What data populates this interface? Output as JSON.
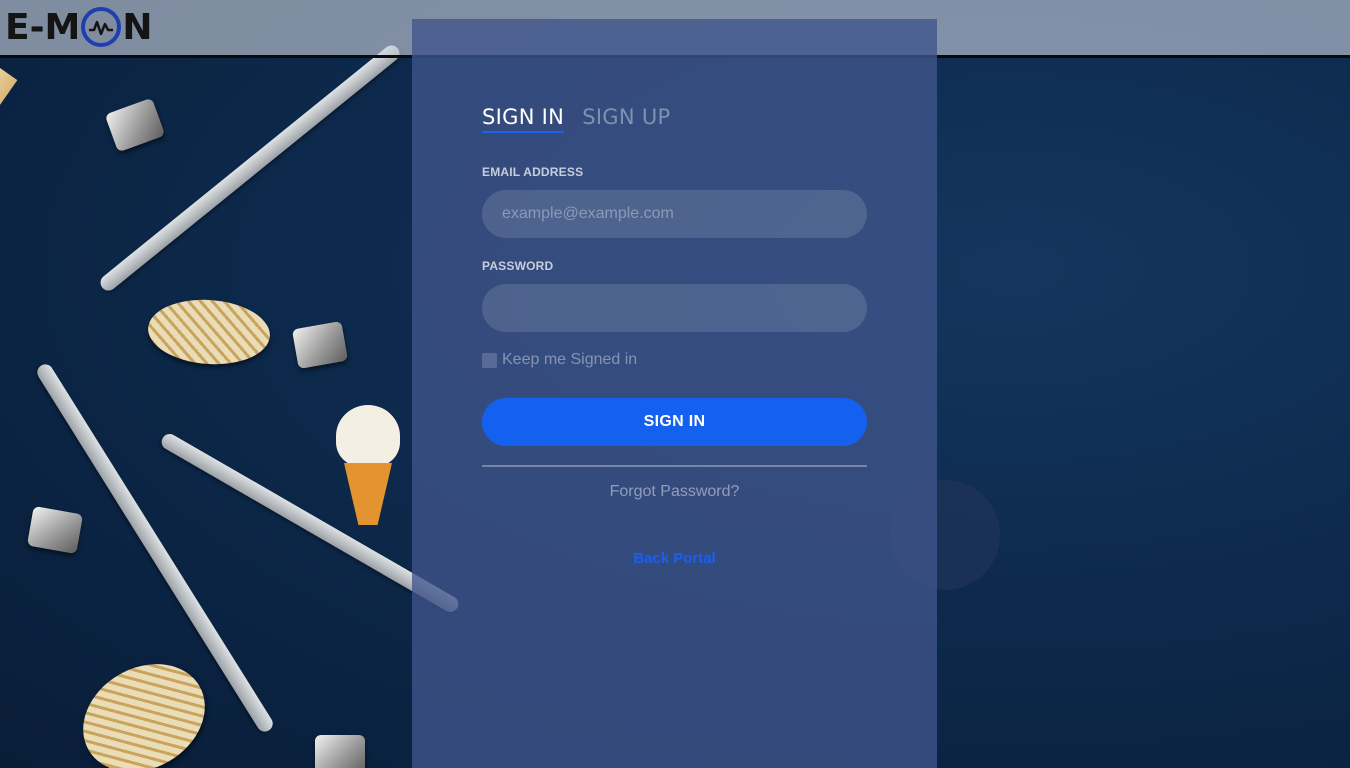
{
  "brand": {
    "logo_left": "E-M",
    "logo_right": "N"
  },
  "tabs": [
    {
      "label": "SIGN IN",
      "active": true
    },
    {
      "label": "SIGN UP",
      "active": false
    }
  ],
  "form": {
    "email_label": "EMAIL ADDRESS",
    "email_placeholder": "example@example.com",
    "password_label": "PASSWORD",
    "password_value": "",
    "keep_signed_in_label": "Keep me Signed in",
    "keep_signed_in_checked": false,
    "submit_label": "SIGN IN",
    "forgot_label": "Forgot Password?",
    "back_label": "Back Portal"
  },
  "colors": {
    "accent": "#1461ef",
    "logo_ring": "#1f3fb0",
    "panel": "#40548c"
  }
}
